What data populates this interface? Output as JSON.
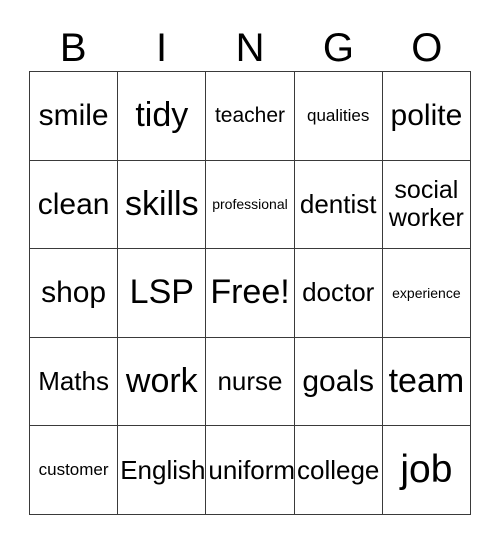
{
  "card": {
    "header_letters": [
      "B",
      "I",
      "N",
      "G",
      "O"
    ],
    "rows": [
      [
        {
          "text": "smile",
          "size": "lg"
        },
        {
          "text": "tidy",
          "size": "xl"
        },
        {
          "text": "teacher",
          "size": "sm"
        },
        {
          "text": "qualities",
          "size": "xs"
        },
        {
          "text": "polite",
          "size": "lg"
        }
      ],
      [
        {
          "text": "clean",
          "size": "lg"
        },
        {
          "text": "skills",
          "size": "xl"
        },
        {
          "text": "professional",
          "size": "xxs"
        },
        {
          "text": "dentist",
          "size": "md"
        },
        {
          "text": "social\nworker",
          "size": "two"
        }
      ],
      [
        {
          "text": "shop",
          "size": "lg"
        },
        {
          "text": "LSP",
          "size": "xl"
        },
        {
          "text": "Free!",
          "size": "xl"
        },
        {
          "text": "doctor",
          "size": "md"
        },
        {
          "text": "experience",
          "size": "xxs"
        }
      ],
      [
        {
          "text": "Maths",
          "size": "md"
        },
        {
          "text": "work",
          "size": "xl"
        },
        {
          "text": "nurse",
          "size": "md"
        },
        {
          "text": "goals",
          "size": "lg"
        },
        {
          "text": "team",
          "size": "xl"
        }
      ],
      [
        {
          "text": "customer",
          "size": "xs"
        },
        {
          "text": "English",
          "size": "md"
        },
        {
          "text": "uniform",
          "size": "md"
        },
        {
          "text": "college",
          "size": "md"
        },
        {
          "text": "job",
          "size": "xxl"
        }
      ]
    ],
    "colors": {
      "background": "#ffffff",
      "text": "#000000",
      "border": "#3a3a3a"
    }
  }
}
